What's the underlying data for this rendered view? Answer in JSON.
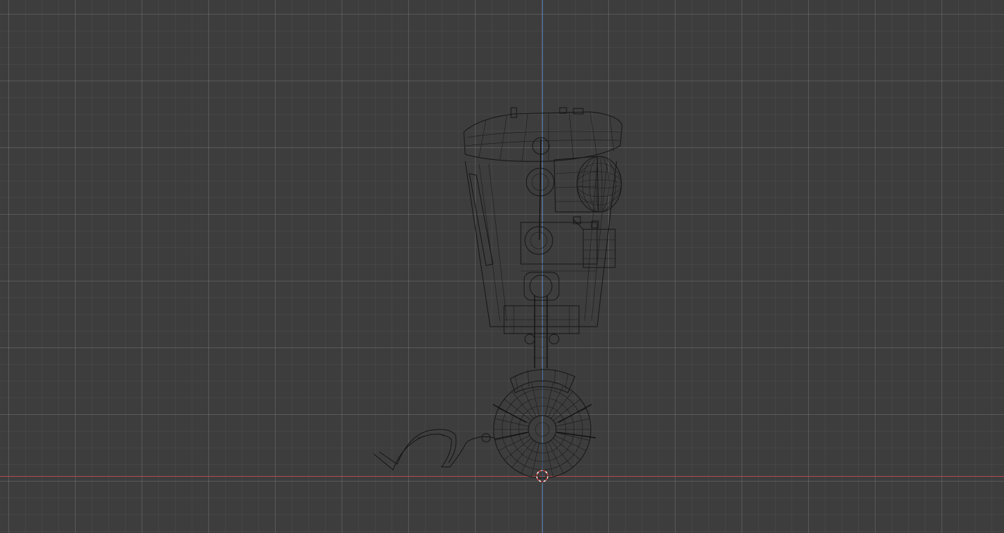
{
  "viewport": {
    "background": "#3d3d3d",
    "x_axis_color": "#b84a4a",
    "z_axis_color": "#4a73a8",
    "display_mode": "wireframe"
  },
  "scene": {
    "object": "robot-model",
    "icons": [
      "3d-cursor-icon"
    ]
  }
}
